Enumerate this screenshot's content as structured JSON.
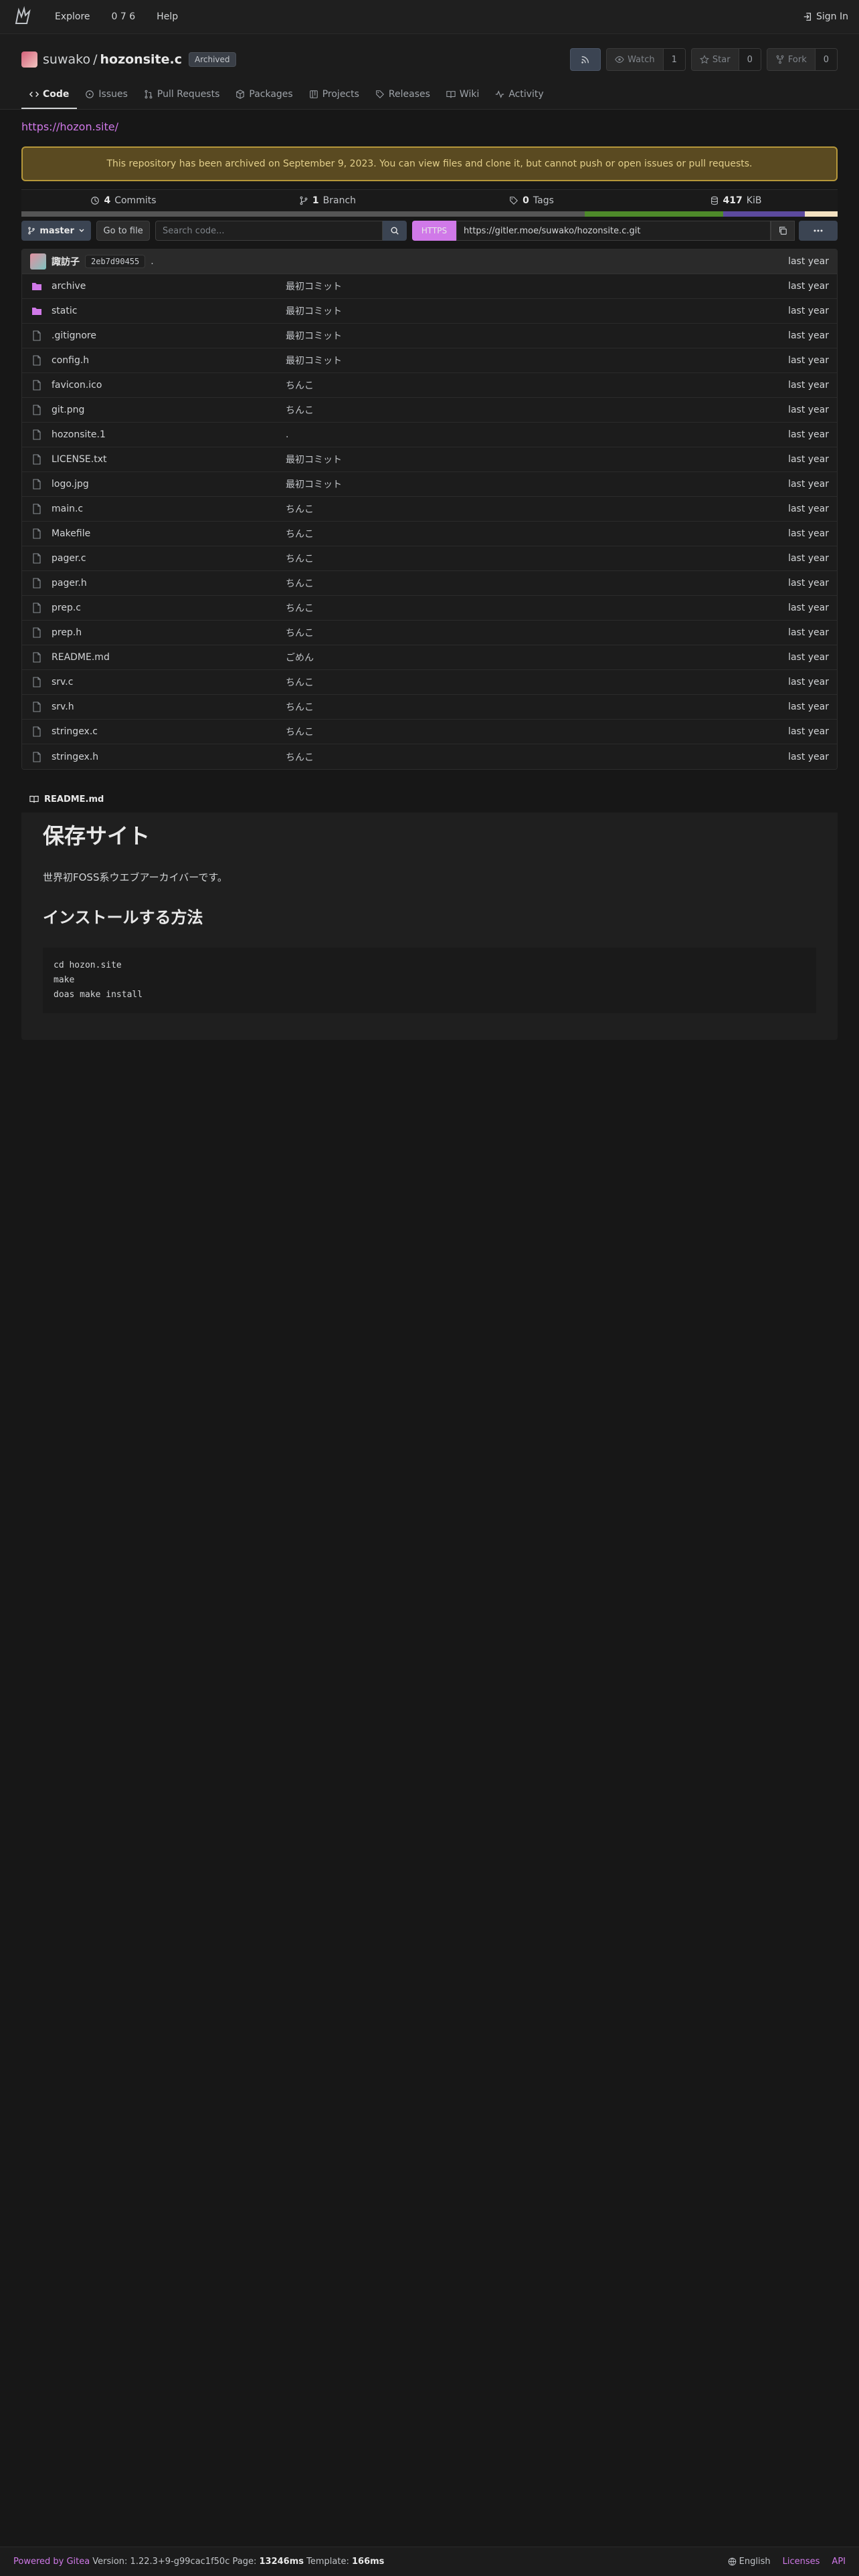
{
  "nav": {
    "logo_name": "gitea-logo",
    "links": [
      "Explore",
      "0 7 6",
      "Help"
    ],
    "signin": "Sign In"
  },
  "repo": {
    "owner": "suwako",
    "separator": "/",
    "name": "hozonsite.c",
    "badge": "Archived",
    "watch_label": "Watch",
    "watch_count": "1",
    "star_label": "Star",
    "star_count": "0",
    "fork_label": "Fork",
    "fork_count": "0"
  },
  "tabs": [
    {
      "label": "Code",
      "icon": "code-icon",
      "active": true
    },
    {
      "label": "Issues",
      "icon": "issue-icon"
    },
    {
      "label": "Pull Requests",
      "icon": "pull-request-icon"
    },
    {
      "label": "Packages",
      "icon": "package-icon"
    },
    {
      "label": "Projects",
      "icon": "project-icon"
    },
    {
      "label": "Releases",
      "icon": "tag-icon"
    },
    {
      "label": "Wiki",
      "icon": "book-icon"
    },
    {
      "label": "Activity",
      "icon": "pulse-icon"
    }
  ],
  "website": "https://hozon.site/",
  "archive_notice": "This repository has been archived on September 9, 2023. You can view files and clone it, but cannot push or open issues or pull requests.",
  "stats": {
    "commits_count": "4",
    "commits_label": "Commits",
    "branch_count": "1",
    "branch_label": "Branch",
    "tags_count": "0",
    "tags_label": "Tags",
    "size_value": "417",
    "size_unit": "KiB"
  },
  "languages": [
    {
      "color": "#555555",
      "share": 0.69
    },
    {
      "color": "#4e8a2a",
      "share": 0.17
    },
    {
      "color": "#5c4a9e",
      "share": 0.1
    },
    {
      "color": "#f3e1c0",
      "share": 0.04
    }
  ],
  "toolbar": {
    "branch": "master",
    "goto_file": "Go to file",
    "search_placeholder": "Search code...",
    "clone_protocol": "HTTPS",
    "clone_url": "https://gitler.moe/suwako/hozonsite.c.git"
  },
  "latest_commit": {
    "author": "諏訪子",
    "sha": "2eb7d90455",
    "message": ".",
    "time": "last year"
  },
  "files": [
    {
      "name": "archive",
      "type": "dir",
      "commit": "最初コミット",
      "time": "last year"
    },
    {
      "name": "static",
      "type": "dir",
      "commit": "最初コミット",
      "time": "last year"
    },
    {
      "name": ".gitignore",
      "type": "file",
      "commit": "最初コミット",
      "time": "last year"
    },
    {
      "name": "config.h",
      "type": "file",
      "commit": "最初コミット",
      "time": "last year"
    },
    {
      "name": "favicon.ico",
      "type": "file",
      "commit": "ちんこ",
      "time": "last year"
    },
    {
      "name": "git.png",
      "type": "file",
      "commit": "ちんこ",
      "time": "last year"
    },
    {
      "name": "hozonsite.1",
      "type": "file",
      "commit": ".",
      "time": "last year"
    },
    {
      "name": "LICENSE.txt",
      "type": "file",
      "commit": "最初コミット",
      "time": "last year"
    },
    {
      "name": "logo.jpg",
      "type": "file",
      "commit": "最初コミット",
      "time": "last year"
    },
    {
      "name": "main.c",
      "type": "file",
      "commit": "ちんこ",
      "time": "last year"
    },
    {
      "name": "Makefile",
      "type": "file",
      "commit": "ちんこ",
      "time": "last year"
    },
    {
      "name": "pager.c",
      "type": "file",
      "commit": "ちんこ",
      "time": "last year"
    },
    {
      "name": "pager.h",
      "type": "file",
      "commit": "ちんこ",
      "time": "last year"
    },
    {
      "name": "prep.c",
      "type": "file",
      "commit": "ちんこ",
      "time": "last year"
    },
    {
      "name": "prep.h",
      "type": "file",
      "commit": "ちんこ",
      "time": "last year"
    },
    {
      "name": "README.md",
      "type": "file",
      "commit": "ごめん",
      "time": "last year"
    },
    {
      "name": "srv.c",
      "type": "file",
      "commit": "ちんこ",
      "time": "last year"
    },
    {
      "name": "srv.h",
      "type": "file",
      "commit": "ちんこ",
      "time": "last year"
    },
    {
      "name": "stringex.c",
      "type": "file",
      "commit": "ちんこ",
      "time": "last year"
    },
    {
      "name": "stringex.h",
      "type": "file",
      "commit": "ちんこ",
      "time": "last year"
    }
  ],
  "readme": {
    "filename": "README.md",
    "h1": "保存サイト",
    "paragraph": "世界初FOSS系ウエブアーカイバーです。",
    "h2": "インストールする方法",
    "code": "cd hozon.site\nmake\ndoas make install"
  },
  "footer": {
    "powered": "Powered by Gitea",
    "version_label": "Version: 1.22.3+9-g99cac1f50c Page:",
    "page_time": "13246ms",
    "template_label": "Template:",
    "template_time": "166ms",
    "language": "English",
    "licenses": "Licenses",
    "api": "API"
  }
}
